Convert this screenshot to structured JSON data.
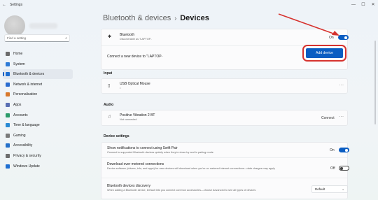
{
  "window": {
    "title": "Settings",
    "back_glyph": "←",
    "minimize_glyph": "—",
    "maximize_glyph": "☐",
    "close_glyph": "✕"
  },
  "sidebar": {
    "search_placeholder": "Find a setting",
    "search_icon": "search-icon",
    "items": [
      {
        "label": "Home",
        "icon": "home-icon",
        "color": "#6b6b6b"
      },
      {
        "label": "System",
        "icon": "monitor-icon",
        "color": "#2e7bd6"
      },
      {
        "label": "Bluetooth & devices",
        "icon": "bluetooth-icon",
        "color": "#1f6fd1",
        "active": true
      },
      {
        "label": "Network & internet",
        "icon": "wifi-icon",
        "color": "#2b6ccf"
      },
      {
        "label": "Personalisation",
        "icon": "brush-icon",
        "color": "#d8782b"
      },
      {
        "label": "Apps",
        "icon": "apps-icon",
        "color": "#5a6fb3"
      },
      {
        "label": "Accounts",
        "icon": "person-icon",
        "color": "#2c9b6a"
      },
      {
        "label": "Time & language",
        "icon": "globe-icon",
        "color": "#2a8ad4"
      },
      {
        "label": "Gaming",
        "icon": "gamepad-icon",
        "color": "#7a7a7a"
      },
      {
        "label": "Accessibility",
        "icon": "accessibility-icon",
        "color": "#2570c9"
      },
      {
        "label": "Privacy & security",
        "icon": "shield-icon",
        "color": "#6d6d6d"
      },
      {
        "label": "Windows Update",
        "icon": "update-icon",
        "color": "#1f6fd1"
      }
    ]
  },
  "main": {
    "breadcrumb_parent": "Bluetooth & devices",
    "breadcrumb_sep": "›",
    "breadcrumb_current": "Devices",
    "bluetooth": {
      "title": "Bluetooth",
      "subtitle": "Discoverable as \"LAPTOP-",
      "state_label": "On",
      "state": true
    },
    "connect": {
      "text": "Connect a new device to \"LAPTOP-",
      "button_label": "Add device"
    },
    "input_section": "Input",
    "mouse": {
      "title": "USB Optical Mouse",
      "subtitle": "•",
      "more": "···"
    },
    "audio_section": "Audio",
    "audio_device": {
      "title": "Positive Vibration 2 BT",
      "subtitle": "Not connected",
      "action": "Connect",
      "more": "···"
    },
    "device_settings_section": "Device settings",
    "swift_pair": {
      "title": "Show notifications to connect using Swift Pair",
      "subtitle": "Connect to supported Bluetooth devices quickly when they're close by and in pairing mode",
      "state_label": "On",
      "state": true
    },
    "metered": {
      "title": "Download over metered connections",
      "subtitle": "Device software (drivers, info, and apps) for new devices will download when you're on metered internet connections—data charges may apply",
      "state_label": "Off",
      "state": false
    },
    "discovery": {
      "title": "Bluetooth devices discovery",
      "subtitle": "When adding a Bluetooth device, Default lets you connect common accessories—choose Advanced to see all types of devices",
      "value": "Default",
      "chevron": "⌄"
    }
  },
  "annotation": {
    "arrow_color": "#d6322e",
    "highlight_color": "#d6322e"
  }
}
